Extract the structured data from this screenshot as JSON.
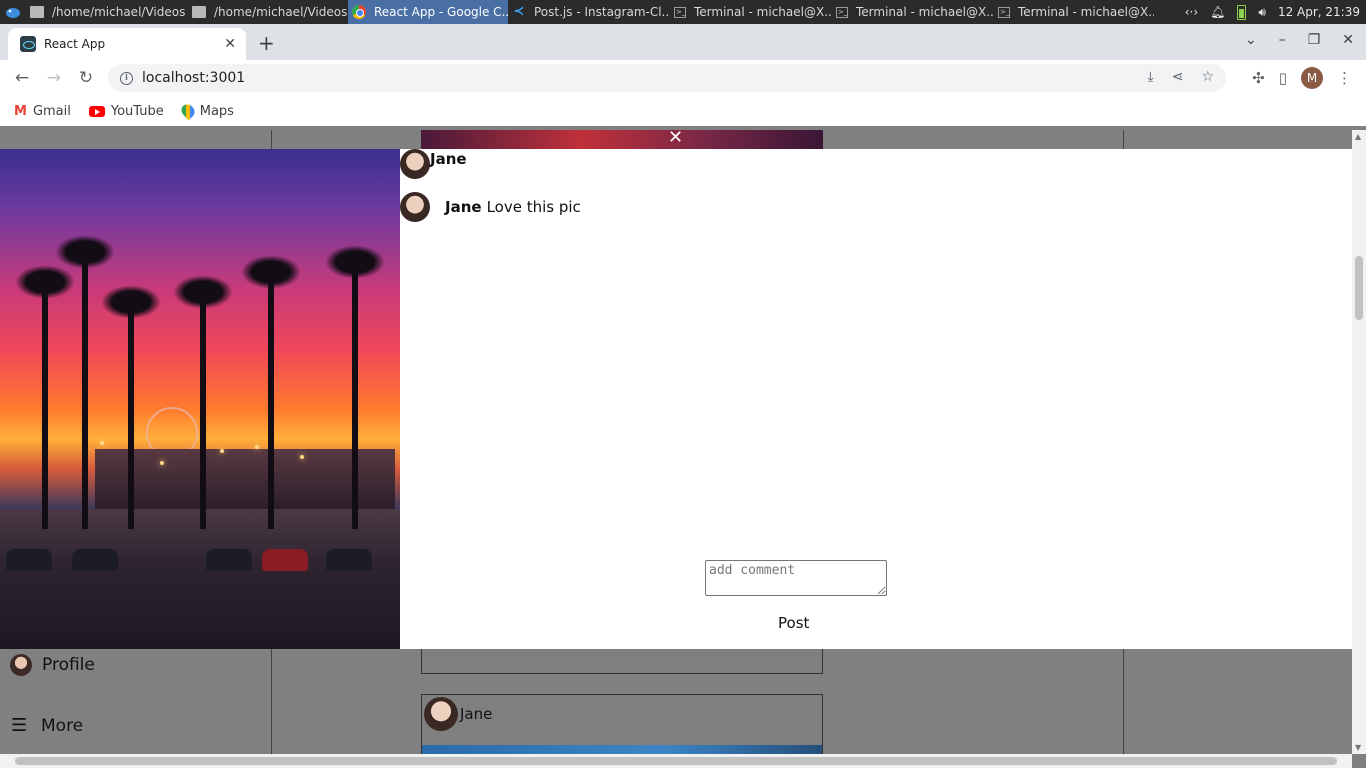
{
  "taskbar": {
    "items": [
      {
        "label": "/home/michael/Videos",
        "icon": "folder-icon"
      },
      {
        "label": "/home/michael/Videos",
        "icon": "folder-icon"
      },
      {
        "label": "React App - Google C...",
        "icon": "chrome-icon"
      },
      {
        "label": "Post.js - Instagram-Cl...",
        "icon": "vscode-icon"
      },
      {
        "label": "Terminal - michael@X...",
        "icon": "terminal-icon"
      },
      {
        "label": "Terminal - michael@X...",
        "icon": "terminal-icon"
      },
      {
        "label": "Terminal - michael@X...",
        "icon": "terminal-icon"
      }
    ],
    "clock": "12 Apr, 21:39"
  },
  "browser": {
    "tab_title": "React App",
    "url": "localhost:3001",
    "bookmarks": [
      {
        "label": "Gmail",
        "icon": "gmail-icon"
      },
      {
        "label": "YouTube",
        "icon": "youtube-icon"
      },
      {
        "label": "Maps",
        "icon": "maps-icon"
      }
    ],
    "profile_initial": "M"
  },
  "page": {
    "sidebar": {
      "profile_label": "Profile",
      "more_label": "More"
    },
    "feed_card_author": "Jane",
    "modal": {
      "close_glyph": "✕",
      "author": "Jane",
      "comments": [
        {
          "user": "Jane",
          "text": "Love this pic"
        }
      ],
      "comment_placeholder": "add comment",
      "post_button": "Post"
    }
  },
  "colors": {
    "taskbar_bg": "#2b2b2b",
    "active_task": "#4a6fa5",
    "overlay": "#808080",
    "modal_bg": "#ffffff"
  }
}
